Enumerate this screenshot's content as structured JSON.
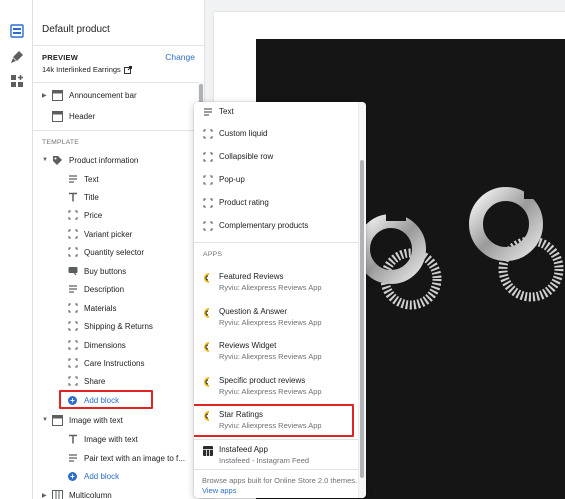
{
  "sidebar": {
    "title": "Default product",
    "preview_label": "PREVIEW",
    "change_label": "Change",
    "preview_value": "14k Interlinked Earrings",
    "announcement_bar": "Announcement bar",
    "header": "Header",
    "template_label": "TEMPLATE",
    "product_information": "Product information",
    "blocks": [
      "Text",
      "Title",
      "Price",
      "Variant picker",
      "Quantity selector",
      "Buy buttons",
      "Description",
      "Materials",
      "Shipping & Returns",
      "Dimensions",
      "Care Instructions",
      "Share"
    ],
    "add_block": "Add block",
    "image_with_text": "Image with text",
    "iwt_blocks": [
      "Image with text",
      "Pair text with an image to f..."
    ],
    "add_block_2": "Add block",
    "multicolumn": "Multicolumn"
  },
  "popup": {
    "items": [
      "Text",
      "Custom liquid",
      "Collapsible row",
      "Pop-up",
      "Product rating",
      "Complementary products"
    ],
    "apps_label": "APPS",
    "apps": [
      {
        "name": "Featured Reviews",
        "sub": "Ryviu: Aliexpress Reviews App"
      },
      {
        "name": "Question & Answer",
        "sub": "Ryviu: Aliexpress Reviews App"
      },
      {
        "name": "Reviews Widget",
        "sub": "Ryviu: Aliexpress Reviews App"
      },
      {
        "name": "Specific product reviews",
        "sub": "Ryviu: Aliexpress Reviews App"
      },
      {
        "name": "Star Ratings",
        "sub": "Ryviu: Aliexpress Reviews App"
      },
      {
        "name": "Instafeed App",
        "sub": "Instafeed - Instagram Feed"
      }
    ],
    "footer_text": "Browse apps built for Online Store 2.0 themes.",
    "footer_link": "View apps"
  },
  "colors": {
    "accent": "#2c6ecb",
    "highlight": "#e02424",
    "image_bg": "#151515"
  }
}
